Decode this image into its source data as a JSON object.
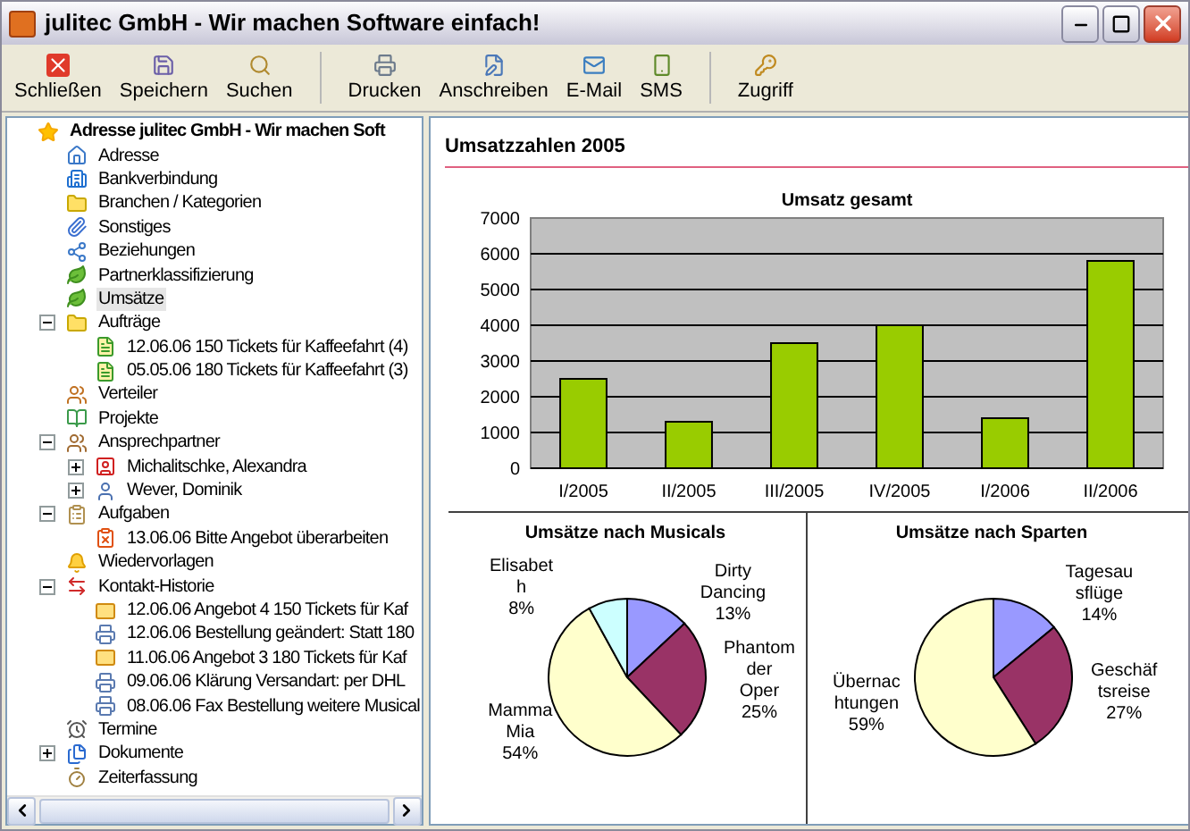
{
  "window": {
    "title": "julitec GmbH - Wir machen Software einfach!"
  },
  "toolbar": [
    {
      "label": "Schließen",
      "kind": "close",
      "separator_after": false
    },
    {
      "label": "Speichern",
      "kind": "save",
      "separator_after": false
    },
    {
      "label": "Suchen",
      "kind": "search",
      "separator_after": true
    },
    {
      "label": "Drucken",
      "kind": "print",
      "separator_after": false
    },
    {
      "label": "Anschreiben",
      "kind": "write",
      "separator_after": false
    },
    {
      "label": "E-Mail",
      "kind": "mail",
      "separator_after": false
    },
    {
      "label": "SMS",
      "kind": "sms",
      "separator_after": true
    },
    {
      "label": "Zugriff",
      "kind": "access",
      "separator_after": false
    }
  ],
  "tree": [
    {
      "label": "Adresse julitec GmbH - Wir machen Soft",
      "kind": "star",
      "selected": false,
      "bold": true,
      "children": [
        {
          "label": "Adresse",
          "kind": "house",
          "selected": false
        },
        {
          "label": "Bankverbindung",
          "kind": "bank",
          "selected": false
        },
        {
          "label": "Branchen / Kategorien",
          "kind": "folder",
          "selected": false
        },
        {
          "label": "Sonstiges",
          "kind": "clip",
          "selected": false
        },
        {
          "label": "Beziehungen",
          "kind": "links",
          "selected": false
        },
        {
          "label": "Partnerklassifizierung",
          "kind": "leaf",
          "selected": false
        },
        {
          "label": "Umsätze",
          "kind": "leaf",
          "selected": true
        },
        {
          "label": "Aufträge",
          "kind": "folder",
          "selected": false,
          "expanded": true,
          "children": [
            {
              "label": "12.06.06 150 Tickets für Kaffeefahrt (4)",
              "kind": "order",
              "selected": false
            },
            {
              "label": "05.05.06 180 Tickets für Kaffeefahrt (3)",
              "kind": "order",
              "selected": false
            }
          ]
        },
        {
          "label": "Verteiler",
          "kind": "distribution",
          "selected": false
        },
        {
          "label": "Projekte",
          "kind": "project",
          "selected": false
        },
        {
          "label": "Ansprechpartner",
          "kind": "contacts",
          "selected": false,
          "expanded": true,
          "children": [
            {
              "label": "Michalitschke, Alexandra",
              "kind": "contact-card",
              "selected": false,
              "expanded": false
            },
            {
              "label": "Wever, Dominik",
              "kind": "contact",
              "selected": false,
              "expanded": false
            }
          ]
        },
        {
          "label": "Aufgaben",
          "kind": "tasks",
          "selected": false,
          "expanded": true,
          "children": [
            {
              "label": "13.06.06 Bitte Angebot überarbeiten",
              "kind": "task",
              "selected": false
            }
          ]
        },
        {
          "label": "Wiedervorlagen",
          "kind": "reminder",
          "selected": false
        },
        {
          "label": "Kontakt-Historie",
          "kind": "history",
          "selected": false,
          "expanded": true,
          "children": [
            {
              "label": "12.06.06 Angebot 4 150 Tickets für Kaf",
              "kind": "mail",
              "selected": false
            },
            {
              "label": "12.06.06 Bestellung geändert: Statt 180",
              "kind": "fax",
              "selected": false
            },
            {
              "label": "11.06.06 Angebot 3 180 Tickets für Kaf",
              "kind": "mail",
              "selected": false
            },
            {
              "label": "09.06.06 Klärung Versandart: per DHL",
              "kind": "fax",
              "selected": false
            },
            {
              "label": "08.06.06 Fax Bestellung weitere Musical",
              "kind": "fax",
              "selected": false
            }
          ]
        },
        {
          "label": "Termine",
          "kind": "appointment",
          "selected": false
        },
        {
          "label": "Dokumente",
          "kind": "documents",
          "selected": false,
          "expanded": false
        },
        {
          "label": "Zeiterfassung",
          "kind": "time",
          "selected": false
        }
      ]
    }
  ],
  "panel": {
    "title": "Umsatzzahlen 2005",
    "bar_chart": {
      "chart_data": {
        "type": "bar",
        "title": "Umsatz gesamt",
        "categories": [
          "I/2005",
          "II/2005",
          "III/2005",
          "IV/2005",
          "I/2006",
          "II/2006"
        ],
        "values": [
          2500,
          1300,
          3500,
          4000,
          1400,
          5800
        ],
        "color": "#99cc00",
        "grid": true,
        "ylim": [
          0,
          7000
        ],
        "yticks": [
          0,
          1000,
          2000,
          3000,
          4000,
          5000,
          6000,
          7000
        ]
      }
    },
    "pie_charts": [
      {
        "chart_data": {
          "type": "pie",
          "title": "Umsätze nach Musicals",
          "categories": [
            "Dirty Dancing",
            "Phantom der Oper",
            "Mamma Mia",
            "Elisabet h"
          ],
          "values": [
            13,
            25,
            54,
            8
          ],
          "value_labels": [
            "13%",
            "25%",
            "54%",
            "8%"
          ],
          "colors": [
            "#9999ff",
            "#993366",
            "#ffffcc",
            "#ccffff"
          ]
        }
      },
      {
        "chart_data": {
          "type": "pie",
          "title": "Umsätze nach Sparten",
          "categories": [
            "Tagesau sflüge",
            "Geschäf tsreise",
            "Übernac htungen"
          ],
          "values": [
            14,
            27,
            59
          ],
          "value_labels": [
            "14%",
            "27%",
            "59%"
          ],
          "colors": [
            "#9999ff",
            "#993366",
            "#ffffcc"
          ]
        }
      }
    ]
  }
}
